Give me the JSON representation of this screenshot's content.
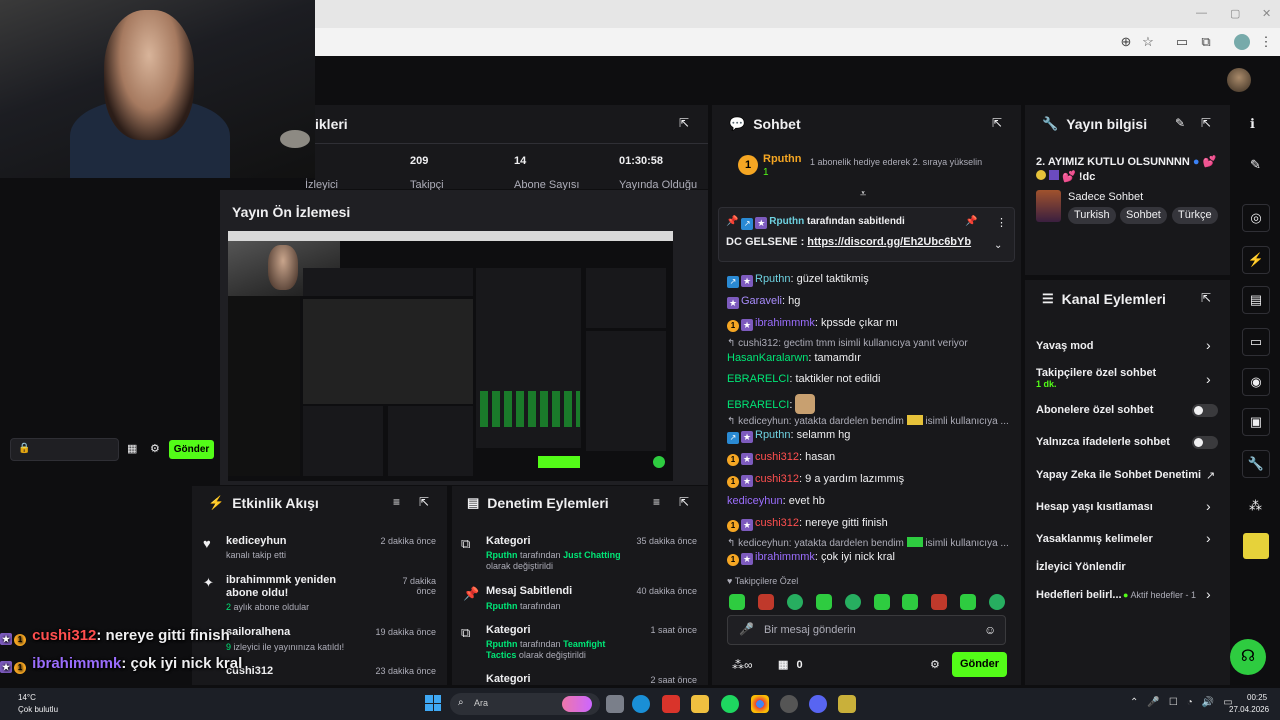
{
  "stats": {
    "viewers_label": "İzleyici",
    "followers_value": "209",
    "followers_label": "Takipçi",
    "subs_value": "14",
    "subs_label": "Abone Sayısı",
    "uptime_value": "01:30:58",
    "uptime_label": "Yayında Olduğu",
    "panel_title_partial": "ikleri"
  },
  "preview": {
    "title": "Yayın Ön İzlemesi"
  },
  "mini_chat": {
    "send_label": "Gönder"
  },
  "chat": {
    "title": "Sohbet",
    "leader_name": "Rputhn",
    "leader_count": "1",
    "leader_note": "1 abonelik hediye ederek 2. sıraya yükselin",
    "pinned_by": "Rputhn",
    "pinned_suffix": "tarafından sabitlendi",
    "pinned_text": "DC GELSENE : ",
    "pinned_link": "https://discord.gg/Eh2Ubc6bYb",
    "messages": [
      {
        "user": "Rputhn",
        "text": ": güzel taktikmiş"
      },
      {
        "user": "Garaveli",
        "text": ": hg"
      },
      {
        "user": "ibrahimmmk",
        "text": ": kpssde çıkar mı"
      },
      {
        "reply": "cushi312: gectim tmm isimli kullanıcıya yanıt veriyor"
      },
      {
        "user": "HasanKaralarwn",
        "text": ": tamamdır"
      },
      {
        "user": "EBRARELCI",
        "text": ": taktikler not edildi"
      },
      {
        "user": "EBRARELCI",
        "text": ":"
      },
      {
        "reply": "kediceyhun: yatakta dardelen bendim",
        "reply_tail": "isimli kullanıcıya ..."
      },
      {
        "user": "Rputhn",
        "text": ": selamm hg"
      },
      {
        "user": "cushi312",
        "text": ": hasan"
      },
      {
        "user": "cushi312",
        "text": ": 9 a yardım lazımmış"
      },
      {
        "user": "kediceyhun",
        "text": ": evet hb"
      },
      {
        "user": "cushi312",
        "text": ": nereye gitti finish"
      },
      {
        "reply": "kediceyhun: yatakta dardelen bendim",
        "reply_tail": "isimli kullanıcıya ..."
      },
      {
        "user": "ibrahimmmk",
        "text": ": çok iyi nick kral"
      }
    ],
    "followers_only": "Takipçilere Özel",
    "input_placeholder": "Bir mesaj gönderin",
    "points": "0",
    "send_label": "Gönder"
  },
  "stream_info": {
    "title": "Yayın bilgisi",
    "stream_title": "2. AYIMIZ KUTLU OLSUNNNN",
    "stream_title_line2": "!dc",
    "category": "Sadece Sohbet",
    "tags": [
      "Turkish",
      "Sohbet",
      "Türkçe"
    ]
  },
  "channel_actions": {
    "title": "Kanal Eylemleri",
    "rows": [
      {
        "label": "Yavaş mod"
      },
      {
        "label": "Takipçilere özel sohbet",
        "sub": "1 dk."
      },
      {
        "label": "Abonelere özel sohbet"
      },
      {
        "label": "Yalnızca ifadelerle sohbet"
      },
      {
        "label": "Yapay Zeka ile Sohbet Denetimi"
      },
      {
        "label": "Hesap yaşı kısıtlaması"
      },
      {
        "label": "Yasaklanmış kelimeler"
      },
      {
        "label": "İzleyici Yönlendir"
      },
      {
        "label": "Hedefleri belirl...",
        "sub": "Aktif hedefler - 1"
      }
    ]
  },
  "activity": {
    "title": "Etkinlik Akışı",
    "items": [
      {
        "name": "kediceyhun",
        "detail": "kanalı takip etti",
        "time": "2 dakika önce"
      },
      {
        "name": "ibrahimmmk yeniden abone oldu!",
        "detail_num": "2",
        "detail": "aylık abone oldular",
        "time": "7 dakika önce"
      },
      {
        "name": "sailoralhena",
        "detail_num": "9",
        "detail": "izleyici ile yayınınıza katıldı!",
        "time": "19 dakika önce"
      },
      {
        "name": "cushi312",
        "time": "23 dakika önce"
      }
    ]
  },
  "moderation": {
    "title": "Denetim Eylemleri",
    "items": [
      {
        "name": "Kategori",
        "by": "Rputhn",
        "mid": "tarafından",
        "value": "Just Chatting",
        "tail": "olarak değiştirildi",
        "time": "35 dakika önce"
      },
      {
        "name": "Mesaj Sabitlendi",
        "by": "Rputhn",
        "mid": "tarafından",
        "time": "40 dakika önce"
      },
      {
        "name": "Kategori",
        "by": "Rputhn",
        "mid": "tarafından",
        "value": "Teamfight Tactics",
        "tail": "olarak değiştirildi",
        "time": "1 saat önce"
      },
      {
        "name": "Kategori",
        "time": "2 saat önce"
      }
    ]
  },
  "overlay": [
    {
      "user": "cushi312",
      "text": ": nereye gitti finish"
    },
    {
      "user": "ibrahimmmk",
      "text": ": çok iyi nick kral"
    }
  ],
  "taskbar": {
    "weather_temp": "14°C",
    "weather_desc": "Çok bulutlu",
    "search": "Ara",
    "time": "00:25",
    "date": "27.04.2026"
  },
  "colors": {
    "accent": "#53fc18",
    "panel": "#18181b",
    "bg": "#0e0e10"
  }
}
